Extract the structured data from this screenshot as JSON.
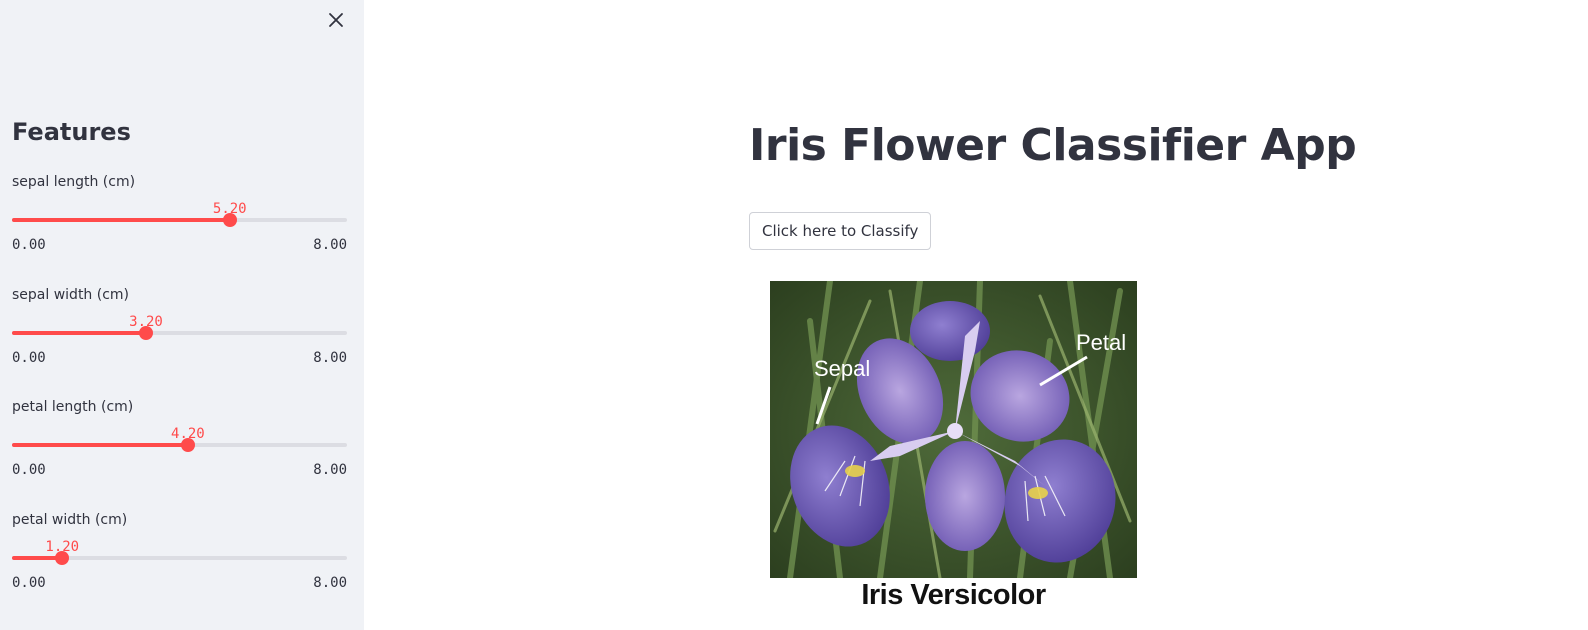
{
  "sidebar": {
    "close_icon": "close-icon",
    "title": "Features",
    "sliders": [
      {
        "label": "sepal length (cm)",
        "value": "5.20",
        "min": "0.00",
        "max": "8.00",
        "fraction": 0.65
      },
      {
        "label": "sepal width (cm)",
        "value": "3.20",
        "min": "0.00",
        "max": "8.00",
        "fraction": 0.4
      },
      {
        "label": "petal length (cm)",
        "value": "4.20",
        "min": "0.00",
        "max": "8.00",
        "fraction": 0.525
      },
      {
        "label": "petal width (cm)",
        "value": "1.20",
        "min": "0.00",
        "max": "8.00",
        "fraction": 0.15
      }
    ]
  },
  "main": {
    "title": "Iris Flower Classifier App",
    "classify_button": "Click here to Classify",
    "image": {
      "label_sepal": "Sepal",
      "label_petal": "Petal",
      "caption": "Iris Versicolor"
    }
  },
  "colors": {
    "accent": "#ff4b4b",
    "sidebar_bg": "#f0f2f6",
    "text": "#31333f"
  }
}
